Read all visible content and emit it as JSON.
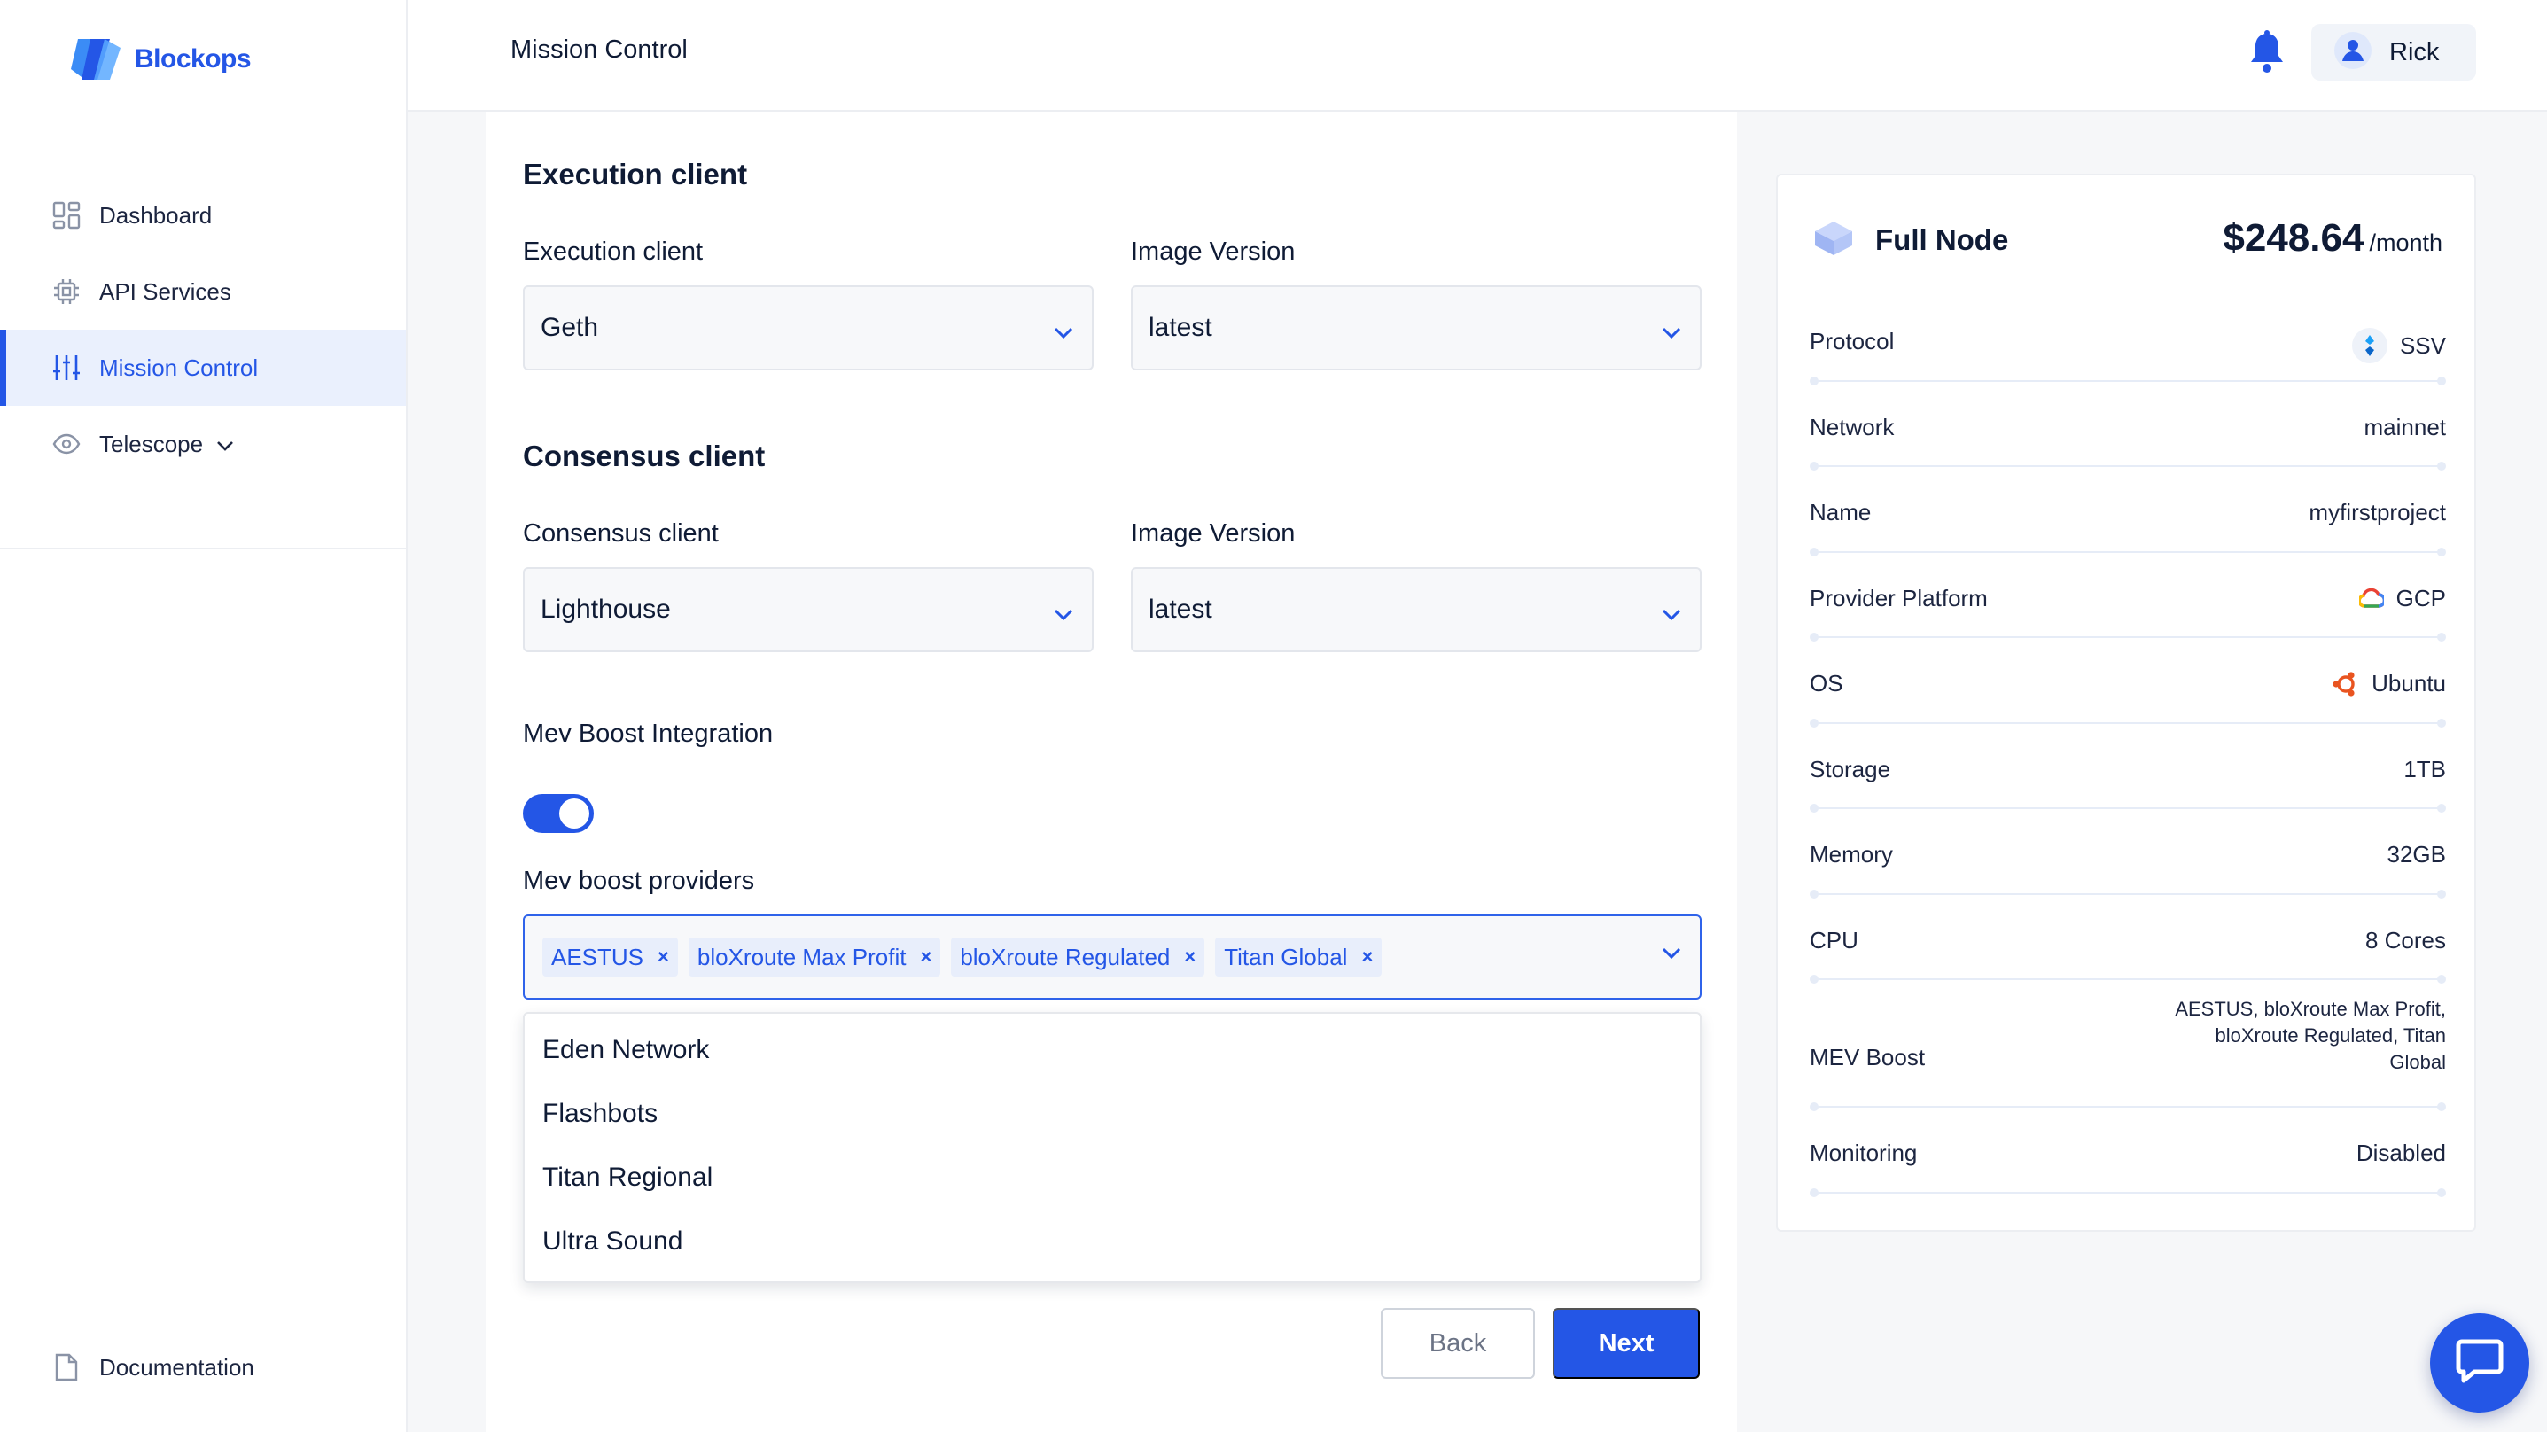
{
  "brand": {
    "name": "Blockops",
    "accent": "#2456e6"
  },
  "sidebar": {
    "items": [
      {
        "label": "Dashboard",
        "icon": "dashboard-icon"
      },
      {
        "label": "API Services",
        "icon": "chip-icon"
      },
      {
        "label": "Mission Control",
        "icon": "sliders-icon",
        "active": true
      },
      {
        "label": "Telescope",
        "icon": "eye-icon"
      }
    ],
    "documentation": "Documentation"
  },
  "header": {
    "title": "Mission Control",
    "user": "Rick"
  },
  "form": {
    "execution": {
      "section_title": "Execution client",
      "client_label": "Execution client",
      "client_value": "Geth",
      "version_label": "Image Version",
      "version_value": "latest"
    },
    "consensus": {
      "section_title": "Consensus client",
      "client_label": "Consensus client",
      "client_value": "Lighthouse",
      "version_label": "Image Version",
      "version_value": "latest"
    },
    "mev": {
      "integration_label": "Mev Boost Integration",
      "enabled": true,
      "providers_label": "Mev boost providers",
      "selected": [
        "AESTUS",
        "bloXroute Max Profit",
        "bloXroute Regulated",
        "Titan Global"
      ],
      "options": [
        "Eden Network",
        "Flashbots",
        "Titan Regional",
        "Ultra Sound"
      ]
    },
    "buttons": {
      "back": "Back",
      "next": "Next"
    }
  },
  "summary": {
    "node_type": "Full Node",
    "price": "$248.64",
    "per": "/month",
    "rows": [
      {
        "key": "Protocol",
        "value": "SSV",
        "icon": "ssv-icon"
      },
      {
        "key": "Network",
        "value": "mainnet"
      },
      {
        "key": "Name",
        "value": "myfirstproject"
      },
      {
        "key": "Provider Platform",
        "value": "GCP",
        "icon": "gcp-icon"
      },
      {
        "key": "OS",
        "value": "Ubuntu",
        "icon": "ubuntu-icon"
      },
      {
        "key": "Storage",
        "value": "1TB"
      },
      {
        "key": "Memory",
        "value": "32GB"
      },
      {
        "key": "CPU",
        "value": "8 Cores"
      },
      {
        "key": "MEV Boost",
        "value": "AESTUS, bloXroute Max Profit, bloXroute Regulated, Titan Global"
      },
      {
        "key": "Monitoring",
        "value": "Disabled"
      }
    ]
  }
}
